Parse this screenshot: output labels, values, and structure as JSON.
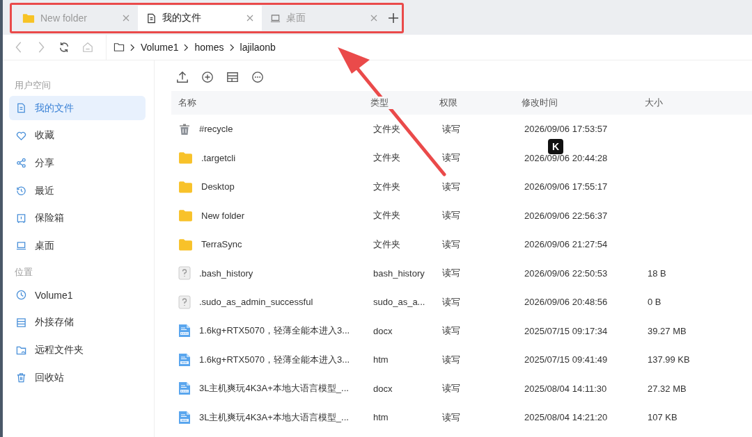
{
  "tabs": [
    {
      "label": "New folder",
      "kind": "folder",
      "selected": false
    },
    {
      "label": "我的文件",
      "kind": "doc",
      "selected": true
    },
    {
      "label": "桌面",
      "kind": "desktop",
      "selected": false
    }
  ],
  "breadcrumb": [
    "Volume1",
    "homes",
    "lajilaonb"
  ],
  "sidebar": {
    "sections": [
      {
        "title": "用户空间",
        "items": [
          {
            "label": "我的文件",
            "kind": "doc",
            "selected": true
          },
          {
            "label": "收藏",
            "kind": "heart",
            "selected": false
          },
          {
            "label": "分享",
            "kind": "share",
            "selected": false
          },
          {
            "label": "最近",
            "kind": "recent",
            "selected": false
          },
          {
            "label": "保险箱",
            "kind": "safe",
            "selected": false
          },
          {
            "label": "桌面",
            "kind": "desktop",
            "selected": false
          }
        ]
      },
      {
        "title": "位置",
        "items": [
          {
            "label": "Volume1",
            "kind": "clock",
            "selected": false
          },
          {
            "label": "外接存储",
            "kind": "storage",
            "selected": false
          },
          {
            "label": "远程文件夹",
            "kind": "remote",
            "selected": false
          },
          {
            "label": "回收站",
            "kind": "trash",
            "selected": false
          }
        ]
      }
    ]
  },
  "table": {
    "columns": [
      "名称",
      "类型",
      "权限",
      "修改时间",
      "大小"
    ],
    "rows": [
      {
        "kind": "trash",
        "name": "#recycle",
        "type": "文件夹",
        "perm": "读写",
        "time": "2026/09/06 17:53:57",
        "size": ""
      },
      {
        "kind": "folder",
        "name": ".targetcli",
        "type": "文件夹",
        "perm": "读写",
        "time": "2026/09/06 20:44:28",
        "size": ""
      },
      {
        "kind": "folder",
        "name": "Desktop",
        "type": "文件夹",
        "perm": "读写",
        "time": "2026/09/06 17:55:17",
        "size": ""
      },
      {
        "kind": "folder",
        "name": "New folder",
        "type": "文件夹",
        "perm": "读写",
        "time": "2026/09/06 22:56:37",
        "size": ""
      },
      {
        "kind": "folder",
        "name": "TerraSync",
        "type": "文件夹",
        "perm": "读写",
        "time": "2026/09/06 21:27:54",
        "size": ""
      },
      {
        "kind": "unknown",
        "name": ".bash_history",
        "type": "bash_history",
        "perm": "读写",
        "time": "2026/09/06 22:50:53",
        "size": "18 B"
      },
      {
        "kind": "unknown",
        "name": ".sudo_as_admin_successful",
        "type": "sudo_as_a...",
        "perm": "读写",
        "time": "2026/09/06 20:48:56",
        "size": "0 B"
      },
      {
        "kind": "docx",
        "name": "1.6kg+RTX5070，轻薄全能本进入3...",
        "type": "docx",
        "perm": "读写",
        "time": "2025/07/15 09:17:34",
        "size": "39.27 MB"
      },
      {
        "kind": "htm",
        "name": "1.6kg+RTX5070，轻薄全能本进入3...",
        "type": "htm",
        "perm": "读写",
        "time": "2025/07/15 09:41:49",
        "size": "137.99 KB"
      },
      {
        "kind": "docx",
        "name": "3L主机爽玩4K3A+本地大语言模型_...",
        "type": "docx",
        "perm": "读写",
        "time": "2025/08/04 14:11:30",
        "size": "27.32 MB"
      },
      {
        "kind": "htm",
        "name": "3L主机爽玩4K3A+本地大语言模型_...",
        "type": "htm",
        "perm": "读写",
        "time": "2025/08/04 14:21:20",
        "size": "107 KB"
      }
    ]
  },
  "overlay_badge": "K"
}
